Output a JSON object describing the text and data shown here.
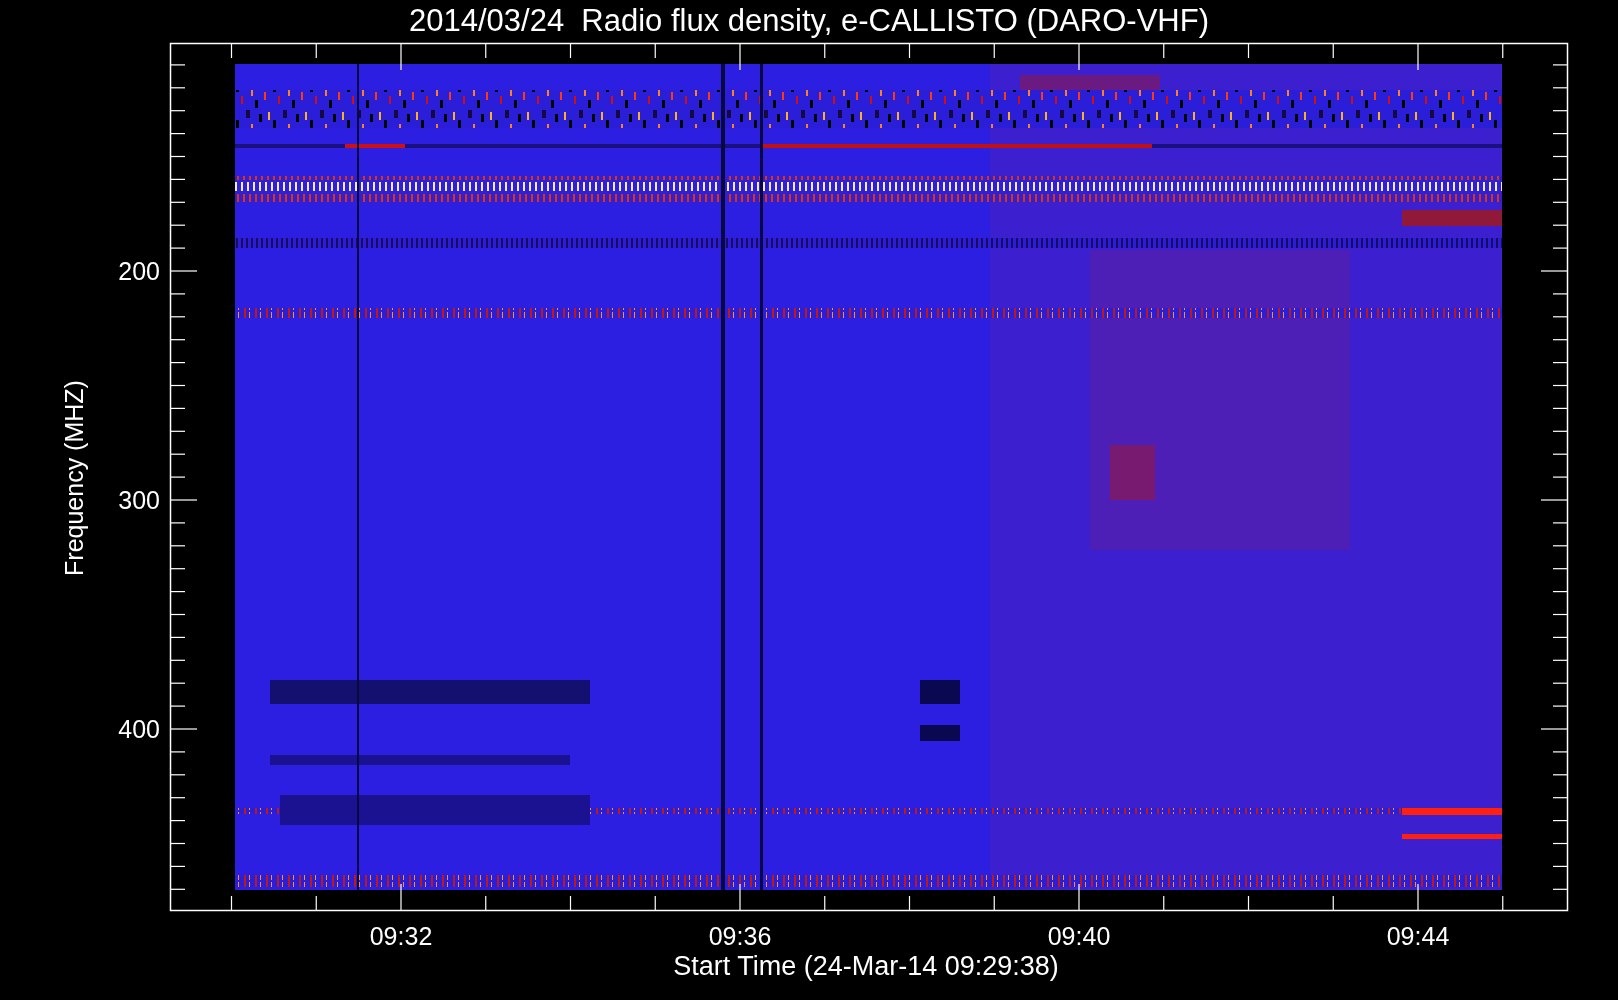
{
  "title": "2014/03/24  Radio flux density, e-CALLISTO (DARO-VHF)",
  "y_axis": {
    "label": "Frequency (MHZ)",
    "ticks": [
      "200",
      "300",
      "400"
    ]
  },
  "x_axis": {
    "label": "Start Time (24-Mar-14 09:29:38)",
    "ticks": [
      "09:32",
      "09:36",
      "09:40",
      "09:44"
    ]
  }
}
